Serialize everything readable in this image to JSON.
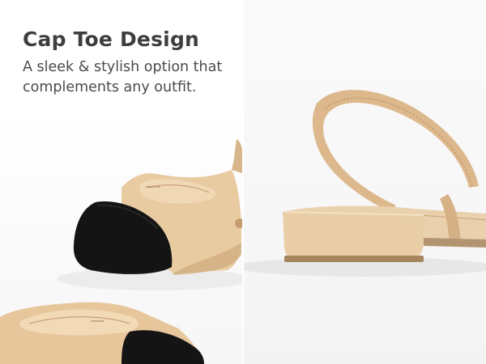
{
  "feature": {
    "title": "Cap Toe Design",
    "description": "A sleek & stylish option that complements any outfit."
  },
  "colors": {
    "leather": "#e8c9a0",
    "leather_shadow": "#c9a275",
    "lining": "#dcb78c",
    "cap_toe": "#121212",
    "heel_sole": "#a98b6a",
    "text": "#3e3e3e"
  },
  "images": [
    {
      "name": "cap-toe-closeup"
    },
    {
      "name": "slingback-heel-side-view"
    }
  ]
}
